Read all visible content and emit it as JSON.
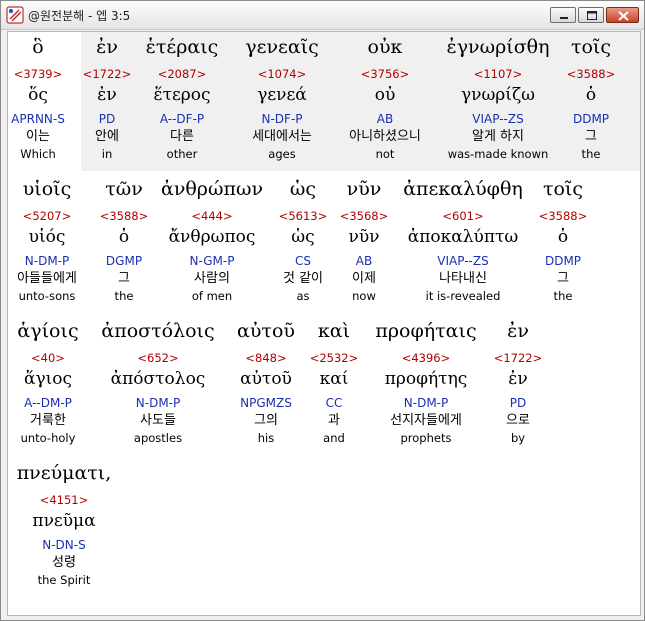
{
  "window": {
    "title": "@원전분해 - 엡 3:5",
    "buttons": {
      "minimize": "minimize",
      "maximize": "maximize",
      "close": "close"
    }
  },
  "words": [
    {
      "greek": "ὃ",
      "strong": "<3739>",
      "lemma": "ὅς",
      "parse": "APRNN-S",
      "korean": "이는",
      "english": "Which"
    },
    {
      "greek": "ἐν",
      "strong": "<1722>",
      "lemma": "ἐν",
      "parse": "PD",
      "korean": "안에",
      "english": "in"
    },
    {
      "greek": "ἑτέραις",
      "strong": "<2087>",
      "lemma": "ἕτερος",
      "parse": "A--DF-P",
      "korean": "다른",
      "english": "other"
    },
    {
      "greek": "γενεαῖς",
      "strong": "<1074>",
      "lemma": "γενεά",
      "parse": "N-DF-P",
      "korean": "세대에서는",
      "english": "ages"
    },
    {
      "greek": "οὐκ",
      "strong": "<3756>",
      "lemma": "οὐ",
      "parse": "AB",
      "korean": "아니하셨으니",
      "english": "not"
    },
    {
      "greek": "ἐγνωρίσθη",
      "strong": "<1107>",
      "lemma": "γνωρίζω",
      "parse": "VIAP--ZS",
      "korean": "알게 하지",
      "english": "was-made known"
    },
    {
      "greek": "τοῖς",
      "strong": "<3588>",
      "lemma": "ὁ",
      "parse": "DDMP",
      "korean": "그",
      "english": "the"
    },
    {
      "greek": "υἱοῖς",
      "strong": "<5207>",
      "lemma": "υἱός",
      "parse": "N-DM-P",
      "korean": "아들들에게",
      "english": "unto-sons"
    },
    {
      "greek": "τῶν",
      "strong": "<3588>",
      "lemma": "ὁ",
      "parse": "DGMP",
      "korean": "그",
      "english": "the"
    },
    {
      "greek": "ἀνθρώπων",
      "strong": "<444>",
      "lemma": "ἄνθρωπος",
      "parse": "N-GM-P",
      "korean": "사람의",
      "english": "of men"
    },
    {
      "greek": "ὡς",
      "strong": "<5613>",
      "lemma": "ὡς",
      "parse": "CS",
      "korean": "것 같이",
      "english": "as"
    },
    {
      "greek": "νῦν",
      "strong": "<3568>",
      "lemma": "νῦν",
      "parse": "AB",
      "korean": "이제",
      "english": "now"
    },
    {
      "greek": "ἀπεκαλύφθη",
      "strong": "<601>",
      "lemma": "ἀποκαλύπτω",
      "parse": "VIAP--ZS",
      "korean": "나타내신",
      "english": "it is-revealed"
    },
    {
      "greek": "τοῖς",
      "strong": "<3588>",
      "lemma": "ὁ",
      "parse": "DDMP",
      "korean": "그",
      "english": "the"
    },
    {
      "greek": "ἁγίοις",
      "strong": "<40>",
      "lemma": "ἅγιος",
      "parse": "A--DM-P",
      "korean": "거룩한",
      "english": "unto-holy"
    },
    {
      "greek": "ἀποστόλοις",
      "strong": "<652>",
      "lemma": "ἀπόστολος",
      "parse": "N-DM-P",
      "korean": "사도들",
      "english": "apostles"
    },
    {
      "greek": "αὐτοῦ",
      "strong": "<848>",
      "lemma": "αὐτοῦ",
      "parse": "NPGMZS",
      "korean": "그의",
      "english": "his"
    },
    {
      "greek": "καὶ",
      "strong": "<2532>",
      "lemma": "καί",
      "parse": "CC",
      "korean": "과",
      "english": "and"
    },
    {
      "greek": "προφήταις",
      "strong": "<4396>",
      "lemma": "προφήτης",
      "parse": "N-DM-P",
      "korean": "선지자들에게",
      "english": "prophets"
    },
    {
      "greek": "ἐν",
      "strong": "<1722>",
      "lemma": "ἐν",
      "parse": "PD",
      "korean": "으로",
      "english": "by"
    },
    {
      "greek": "πνεύματι,",
      "strong": "<4151>",
      "lemma": "πνεῦμα",
      "parse": "N-DN-S",
      "korean": "성령",
      "english": "the Spirit"
    }
  ]
}
